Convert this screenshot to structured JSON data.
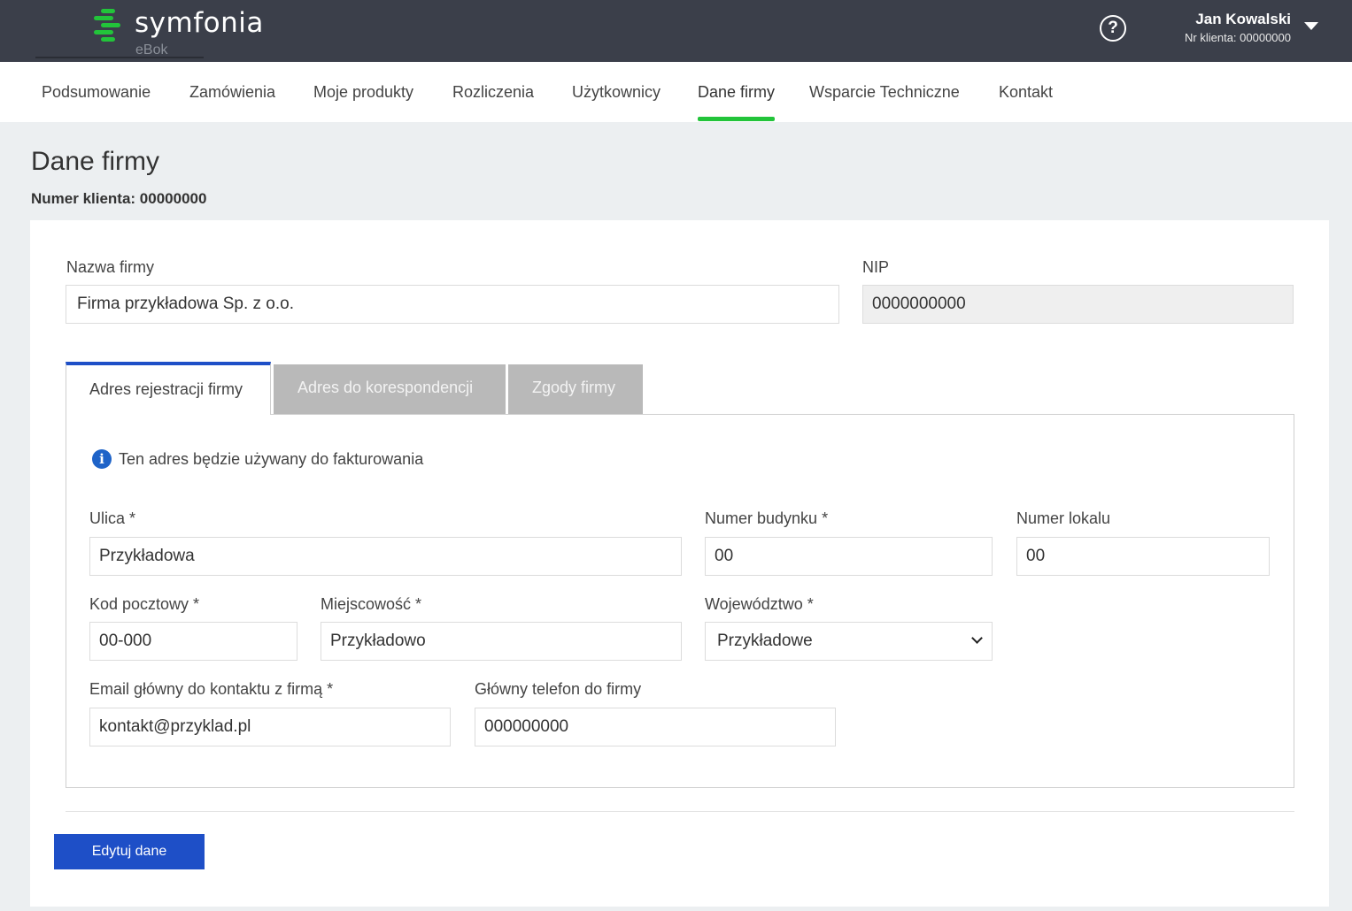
{
  "header": {
    "logo_text": "symfonia",
    "logo_sub": "eBok",
    "help_symbol": "?",
    "user_name": "Jan Kowalski",
    "user_client_nr": "Nr klienta: 00000000",
    "brand_color": "#22c43a",
    "icons": [
      "symfonia-logo-icon",
      "help-circle-icon",
      "caret-down-icon"
    ]
  },
  "nav": {
    "items": [
      {
        "label": "Podsumowanie"
      },
      {
        "label": "Zamówienia"
      },
      {
        "label": "Moje produkty"
      },
      {
        "label": "Rozliczenia"
      },
      {
        "label": "Użytkownicy"
      },
      {
        "label": "Dane firmy"
      },
      {
        "label": "Wsparcie Techniczne"
      },
      {
        "label": "Kontakt"
      }
    ],
    "active": "Dane firmy"
  },
  "page": {
    "title": "Dane firmy",
    "client_nr": "Numer klienta: 00000000"
  },
  "company": {
    "name_label": "Nazwa firmy",
    "name_value": "Firma przykładowa Sp. z o.o.",
    "nip_label": "NIP",
    "nip_value": "0000000000"
  },
  "tabs": [
    {
      "label": "Adres rejestracji firmy",
      "active": true
    },
    {
      "label": "Adres do korespondencji",
      "active": false
    },
    {
      "label": "Zgody firmy",
      "active": false
    }
  ],
  "address": {
    "info_icon": "i",
    "info_text": "Ten adres będzie używany do fakturowania",
    "street_label": "Ulica *",
    "street_value": "Przykładowa",
    "building_label": "Numer budynku *",
    "building_value": "00",
    "apartment_label": "Numer lokalu",
    "apartment_value": "00",
    "postal_label": "Kod pocztowy *",
    "postal_value": "00-000",
    "city_label": "Miejscowość *",
    "city_value": "Przykładowo",
    "voivodeship_label": "Województwo *",
    "voivodeship_value": "Przykładowe",
    "email_label": "Email główny do kontaktu z firmą *",
    "email_value": "kontakt@przyklad.pl",
    "phone_label": "Główny telefon do firmy",
    "phone_value": "000000000"
  },
  "actions": {
    "edit_label": "Edytuj dane",
    "edit_color": "#1e4fc7"
  }
}
